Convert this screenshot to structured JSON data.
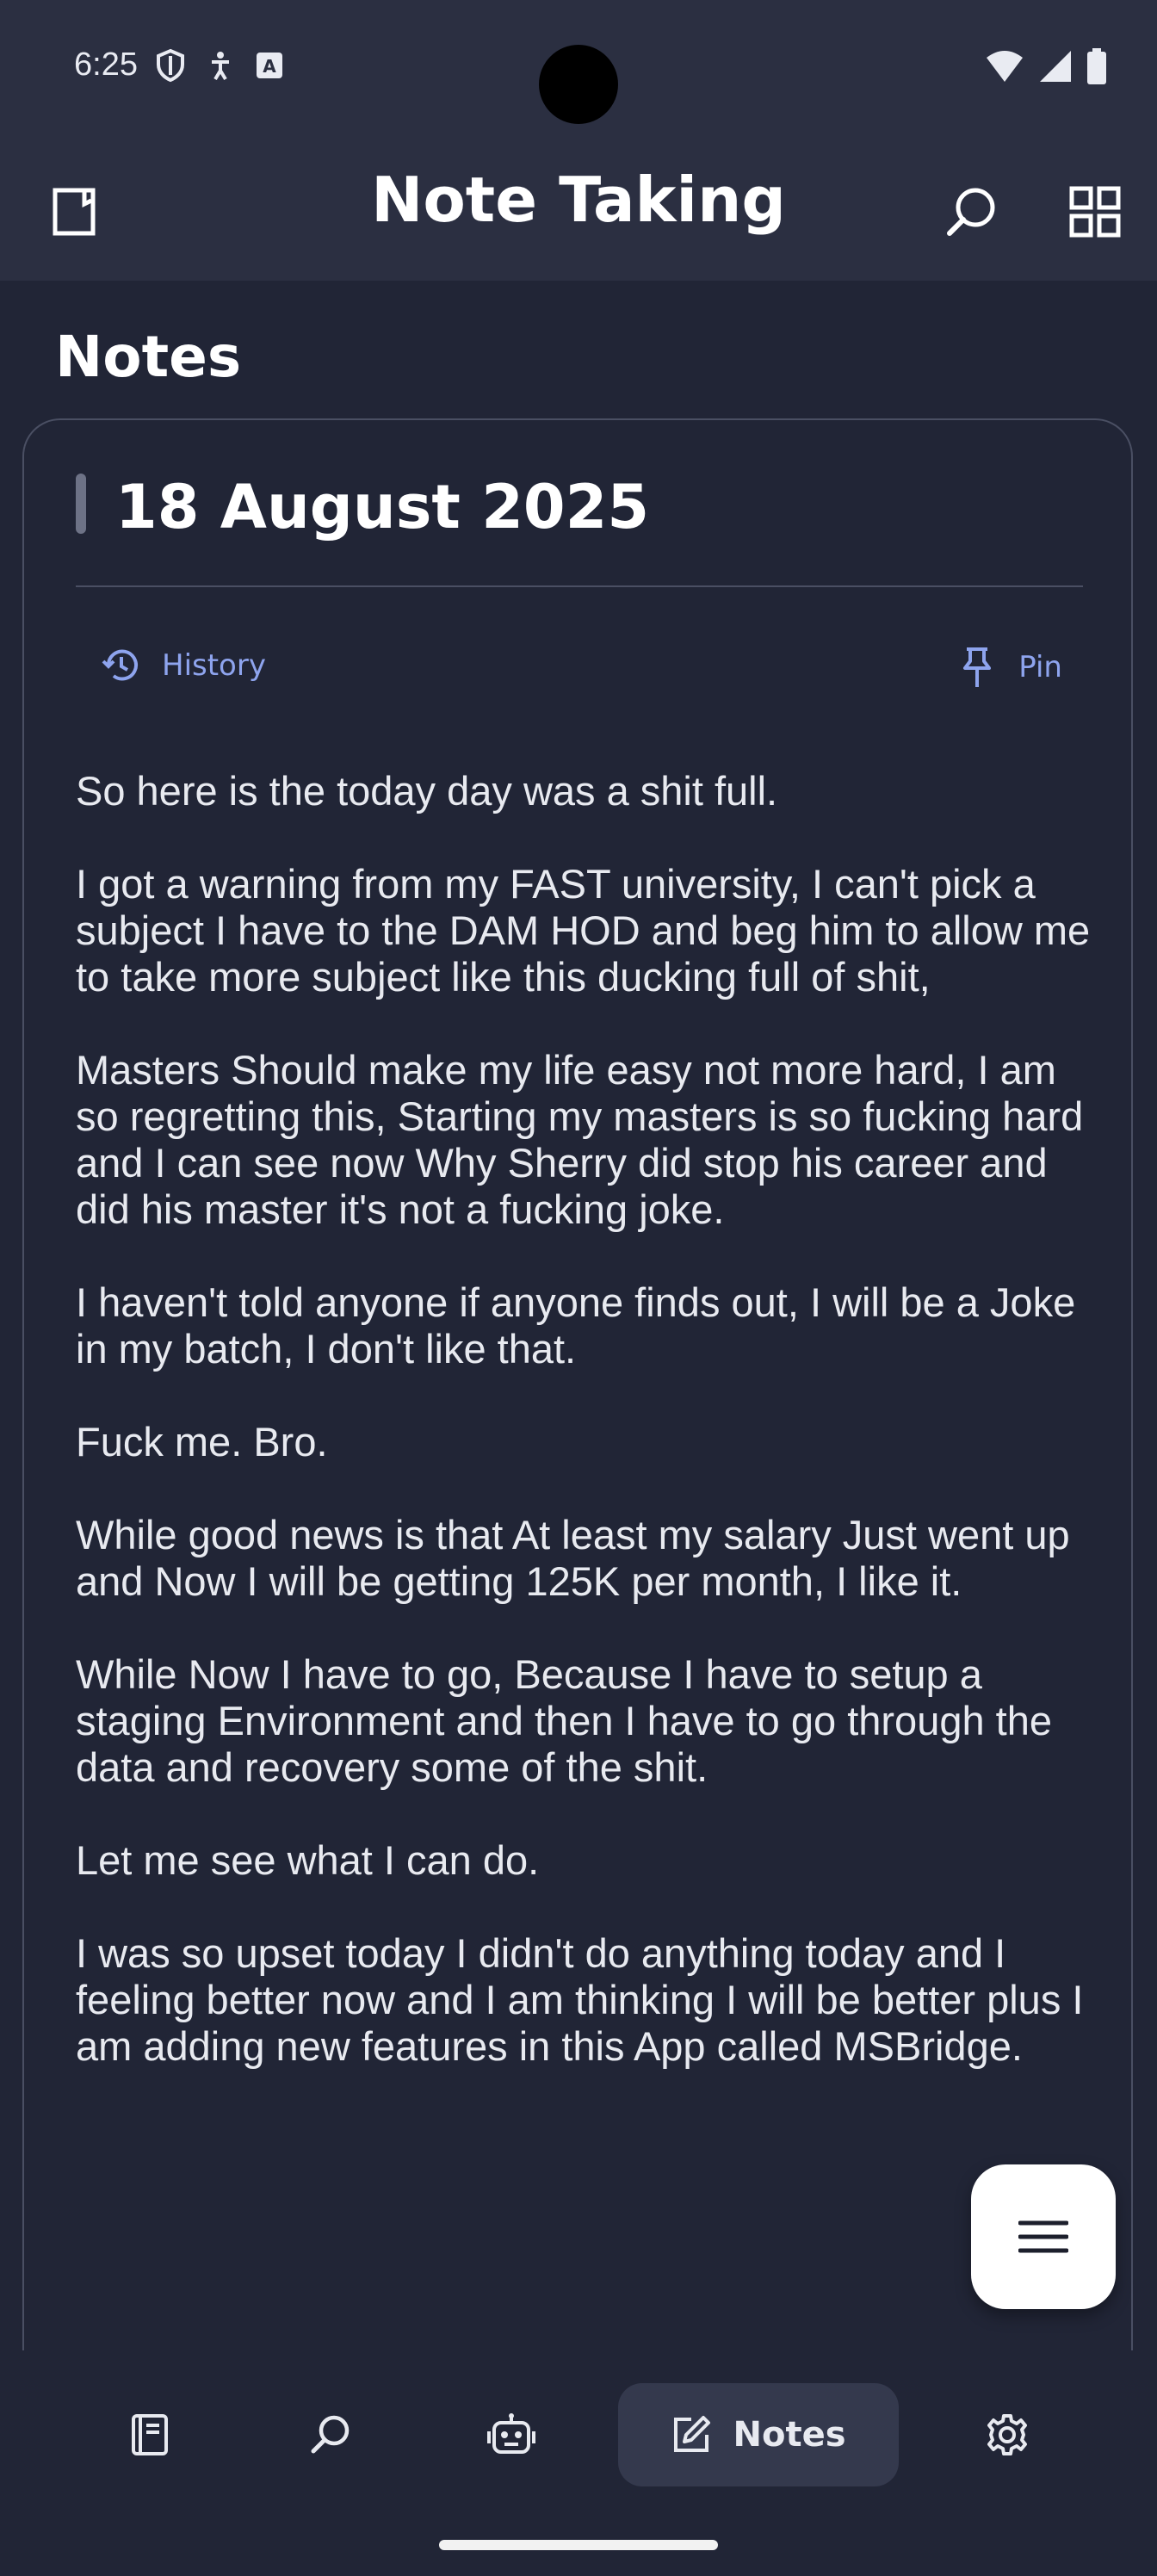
{
  "status_bar": {
    "time": "6:25"
  },
  "app_bar": {
    "title": "Note Taking"
  },
  "section": {
    "title": "Notes"
  },
  "note": {
    "title": "18 August 2025",
    "history_label": "History",
    "pin_label": "Pin",
    "paragraphs": [
      "So here is the today day was a shit full.",
      "I got a warning from my FAST university, I can't pick a subject I have to the DAM HOD and beg him to allow me to take more subject like this ducking full of shit,",
      "Masters Should make my life easy not more hard, I am so regretting this, Starting my masters is so fucking hard and I can see now Why Sherry did stop his career and did his master it's not a fucking joke.",
      "I haven't told anyone if anyone finds out, I will be a Joke in my batch, I don't like that.",
      "Fuck me.  Bro.",
      "While good news is that At least my salary Just went up and Now I will be getting 125K per month, I like it.",
      "While Now I have to go, Because I have to setup a staging Environment and then I have to go through the data and recovery some of the shit.",
      "Let me see what I can do.",
      "I was so upset today I didn't do anything today and I feeling better now and I am thinking I will be better plus I am adding new features in this App called MSBridge."
    ]
  },
  "bottom_nav": {
    "items": [
      {
        "icon": "book-icon"
      },
      {
        "icon": "search-icon"
      },
      {
        "icon": "robot-icon"
      },
      {
        "icon": "edit-note-icon",
        "label": "Notes",
        "active": true
      },
      {
        "icon": "gear-icon"
      }
    ]
  },
  "colors": {
    "background": "#212536",
    "app_bar": "#2b2f41",
    "accent": "#8ea4ee",
    "text": "#e8eaf0"
  }
}
